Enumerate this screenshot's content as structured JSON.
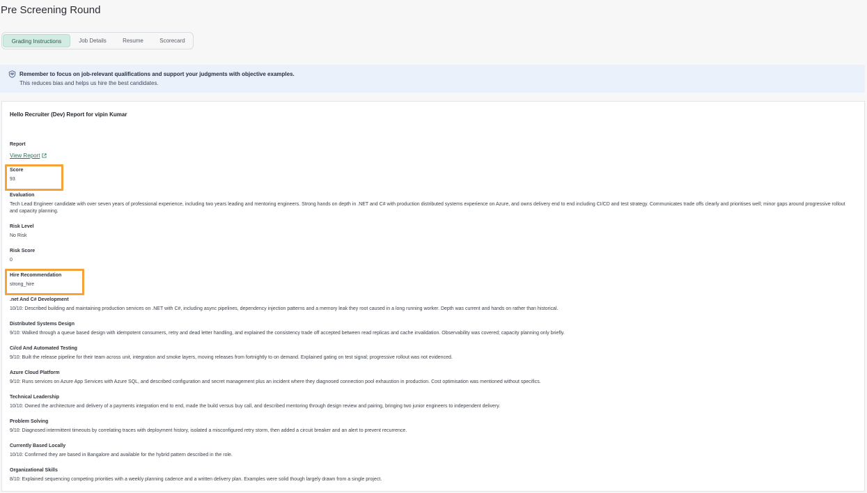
{
  "page": {
    "title": "Pre Screening Round"
  },
  "tabs": [
    {
      "label": "Grading Instructions",
      "active": true
    },
    {
      "label": "Job Details",
      "active": false
    },
    {
      "label": "Resume",
      "active": false
    },
    {
      "label": "Scorecard",
      "active": false
    }
  ],
  "banner": {
    "icon": "shield-brain-icon",
    "line1": "Remember to focus on job-relevant qualifications and support your judgments with objective examples.",
    "line2": "This reduces bias and helps us hire the best candidates."
  },
  "report": {
    "title": "Hello Recruiter (Dev) Report for vipin Kumar",
    "report_label": "Report",
    "view_report_link": "View Report",
    "score_label": "Score",
    "score_value": "93",
    "evaluation_label": "Evaluation",
    "evaluation_value": "Tech Lead Engineer candidate with over seven years of professional experience, including two years leading and mentoring engineers. Strong hands on depth in .NET and C# with production distributed systems experience on Azure, and owns delivery end to end including CI/CD and test strategy. Communicates trade offs clearly and prioritises well; minor gaps around progressive rollout and capacity planning.",
    "risk_level_label": "Risk Level",
    "risk_level_value": "No Risk",
    "risk_score_label": "Risk Score",
    "risk_score_value": "0",
    "hire_rec_label": "Hire Recommendation",
    "hire_rec_value": "strong_hire",
    "criteria": [
      {
        "label": ".net And C# Development",
        "value": "10/10: Described building and maintaining production services on .NET with C#, including async pipelines, dependency injection patterns and a memory leak they root caused in a long running worker. Depth was current and hands on rather than historical."
      },
      {
        "label": "Distributed Systems Design",
        "value": "9/10: Walked through a queue based design with idempotent consumers, retry and dead letter handling, and explained the consistency trade off accepted between read replicas and cache invalidation. Observability was covered; capacity planning only briefly."
      },
      {
        "label": "Ci/cd And Automated Testing",
        "value": "9/10: Built the release pipeline for their team across unit, integration and smoke layers, moving releases from fortnightly to on demand. Explained gating on test signal; progressive rollout was not evidenced."
      },
      {
        "label": "Azure Cloud Platform",
        "value": "9/10: Runs services on Azure App Services with Azure SQL, and described configuration and secret management plus an incident where they diagnosed connection pool exhaustion in production. Cost optimisation was mentioned without specifics."
      },
      {
        "label": "Technical Leadership",
        "value": "10/10: Owned the architecture and delivery of a payments integration end to end, made the build versus buy call, and described mentoring through design review and pairing, bringing two junior engineers to independent delivery."
      },
      {
        "label": "Problem Solving",
        "value": "9/10: Diagnosed intermittent timeouts by correlating traces with deployment history, isolated a misconfigured retry storm, then added a circuit breaker and an alert to prevent recurrence."
      },
      {
        "label": "Currently Based Locally",
        "value": "10/10: Confirmed they are based in Bangalore and available for the hybrid pattern described in the role."
      },
      {
        "label": "Organizational Skills",
        "value": "8/10: Explained sequencing competing priorities with a weekly planning cadence and a written delivery plan. Examples were solid though largely drawn from a single project."
      }
    ]
  },
  "colors": {
    "accent": "#2f6f5c",
    "highlight": "#f5a23a",
    "banner_bg": "#eaf1fb"
  }
}
